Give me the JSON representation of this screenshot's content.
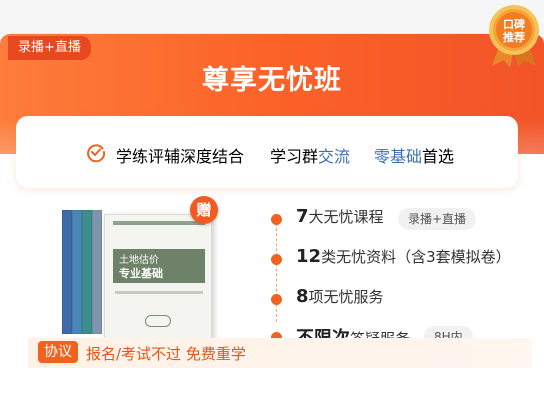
{
  "card": {
    "tag": "录播+直播",
    "title": "尊享无忧班",
    "badge": {
      "line1": "口碑",
      "line2": "推荐"
    }
  },
  "features": {
    "icon": "check-circle-icon",
    "item1": "学练评辅深度结合",
    "item2_prefix": "学习群",
    "item2_highlight": "交流",
    "item3_highlight": "零基础",
    "item3_suffix": "首选"
  },
  "book": {
    "gift_label": "赠",
    "cover_title_line1": "土地估价",
    "cover_title_line2": "专业基础"
  },
  "benefits": [
    {
      "strong": "7",
      "text": "大无忧课程",
      "pill": "录播+直播"
    },
    {
      "strong": "12",
      "text": "类无忧资料（含3套模拟卷）"
    },
    {
      "strong": "8",
      "text": "项无忧服务"
    },
    {
      "strong": "不限次",
      "text": "答疑服务",
      "pill": "8H内"
    }
  ],
  "agreement": {
    "tag": "协议",
    "text": "报名/考试不过 免费重学"
  },
  "colors": {
    "brand_orange": "#f2621f",
    "hero_gradient_start": "#fd7d3c",
    "hero_gradient_end": "#f25428",
    "highlight_blue": "#3a6fb4",
    "badge_gold": "#f3b23a"
  }
}
